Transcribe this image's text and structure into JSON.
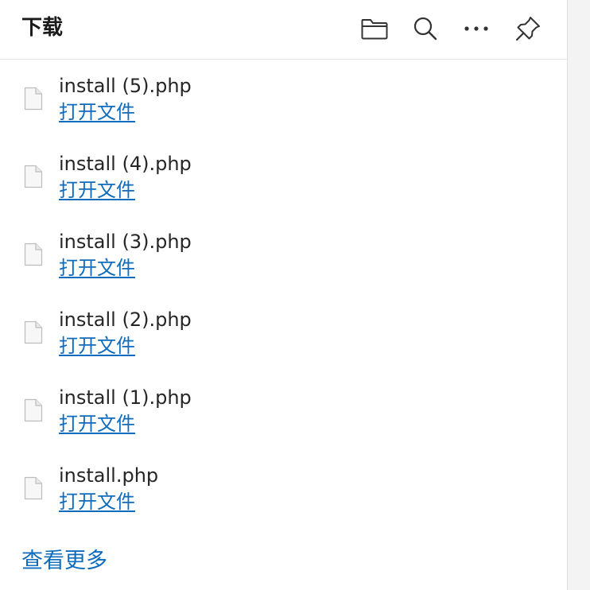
{
  "header": {
    "title": "下载",
    "icons": [
      "folder-icon",
      "search-icon",
      "more-icon",
      "pin-icon"
    ]
  },
  "downloads": [
    {
      "file_name": "install (5).php",
      "action": "打开文件"
    },
    {
      "file_name": "install (4).php",
      "action": "打开文件"
    },
    {
      "file_name": "install (3).php",
      "action": "打开文件"
    },
    {
      "file_name": "install (2).php",
      "action": "打开文件"
    },
    {
      "file_name": "install (1).php",
      "action": "打开文件"
    },
    {
      "file_name": "install.php",
      "action": "打开文件"
    }
  ],
  "footer": {
    "see_more": "查看更多"
  },
  "colors": {
    "link": "#0f6cbd",
    "text": "#262626",
    "background": "#ffffff"
  }
}
